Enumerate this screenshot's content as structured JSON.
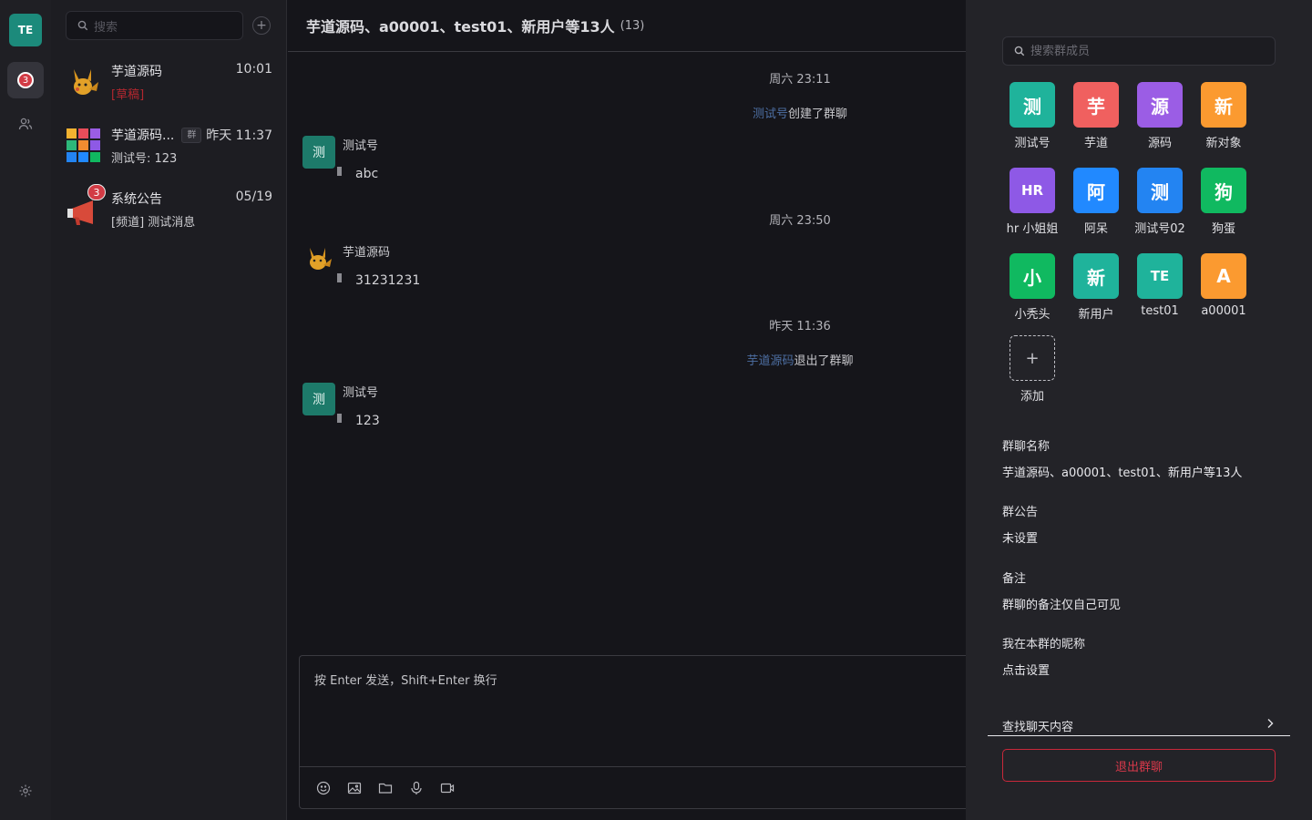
{
  "rail": {
    "me_initials": "TE",
    "unread": "3"
  },
  "conv_list": {
    "search_placeholder": "搜索",
    "add": "+",
    "items": [
      {
        "name": "芋道源码",
        "time": "10:01",
        "msg": "[草稿]"
      },
      {
        "name": "芋道源码...",
        "tag": "群",
        "time": "昨天 11:37",
        "msg": "测试号: 123"
      },
      {
        "name": "系统公告",
        "time": "05/19",
        "msg": "[频道] 测试消息",
        "badge": "3"
      }
    ]
  },
  "chat": {
    "title": "芋道源码、a00001、test01、新用户等13人",
    "count": "(13)",
    "sep1": "周六 23:11",
    "sys1_who": "测试号",
    "sys1_action": "创建了群聊",
    "msg1": {
      "avatar": "测",
      "name": "测试号",
      "text": "abc"
    },
    "sep2": "周六 23:50",
    "msg2": {
      "name": "芋道源码",
      "text": "31231231"
    },
    "sep3": "昨天 11:36",
    "sys2_who": "芋道源码",
    "sys2_action": "退出了群聊",
    "msg3": {
      "avatar": "测",
      "name": "测试号",
      "text": "123"
    },
    "input_placeholder": "按 Enter 发送，Shift+Enter 换行"
  },
  "panel": {
    "search_placeholder": "搜索群成员",
    "members": [
      {
        "char": "测",
        "name": "测试号",
        "color": "#1fb39b"
      },
      {
        "char": "芋",
        "name": "芋道",
        "color": "#f0605f"
      },
      {
        "char": "源",
        "name": "源码",
        "color": "#9b5de5"
      },
      {
        "char": "新",
        "name": "新对象",
        "color": "#fb9a30"
      },
      {
        "char": "HR",
        "name": "hr 小姐姐",
        "color": "#8e59e6"
      },
      {
        "char": "阿",
        "name": "阿呆",
        "color": "#2189ff"
      },
      {
        "char": "测",
        "name": "测试号02",
        "color": "#2384f2"
      },
      {
        "char": "狗",
        "name": "狗蛋",
        "color": "#10b960"
      },
      {
        "char": "小",
        "name": "小秃头",
        "color": "#10b960"
      },
      {
        "char": "新",
        "name": "新用户",
        "color": "#1fb39b"
      },
      {
        "char": "TE",
        "name": "test01",
        "color": "#1fb39b"
      },
      {
        "char": "A",
        "name": "a00001",
        "color": "#fb9a30"
      }
    ],
    "add_symbol": "+",
    "add_label": "添加",
    "group_name_label": "群聊名称",
    "group_name": "芋道源码、a00001、test01、新用户等13人",
    "notice_label": "群公告",
    "notice": "未设置",
    "remark_label": "备注",
    "remark": "群聊的备注仅自己可见",
    "nick_label": "我在本群的昵称",
    "nick": "点击设置",
    "find_label": "查找聊天内容",
    "quit_label": "退出群聊"
  }
}
